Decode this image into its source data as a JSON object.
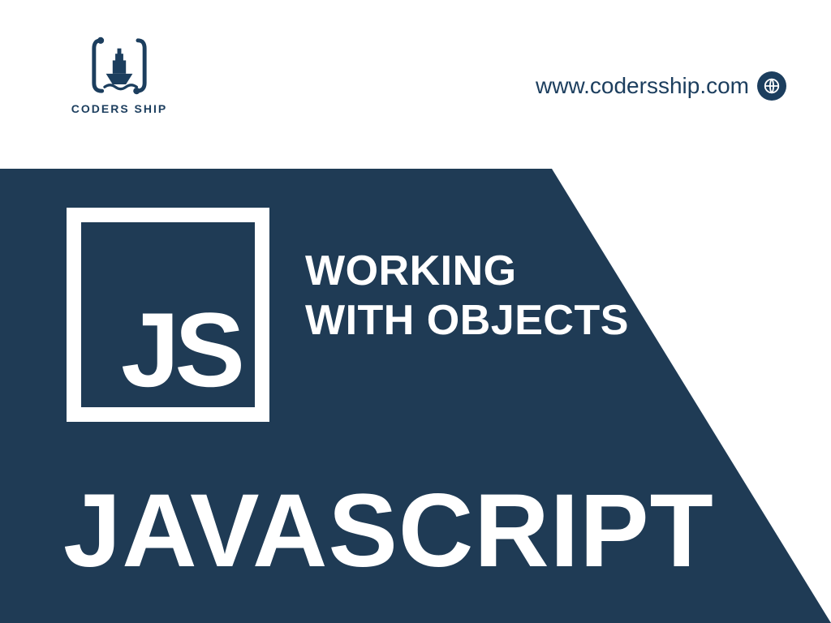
{
  "colors": {
    "brand_navy": "#1c3e5e",
    "panel_navy": "#1f3b55",
    "white": "#ffffff"
  },
  "brand": {
    "name": "CODERS SHIP"
  },
  "site": {
    "url_text": "www.codersship.com"
  },
  "badge": {
    "letters": "JS"
  },
  "subtitle": {
    "text": "WORKING\nWITH OBJECTS"
  },
  "title": {
    "text": "JAVASCRIPT"
  }
}
